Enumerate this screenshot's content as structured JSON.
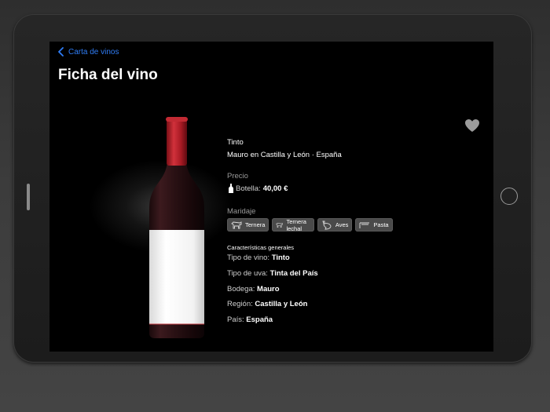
{
  "nav": {
    "back_label": "Carta de vinos"
  },
  "page": {
    "title": "Ficha del vino"
  },
  "wine": {
    "type": "Tinto",
    "origin": "Mauro en Castilla y León · España",
    "price_heading": "Precio",
    "price_label": "Botella:",
    "price_value": "40,00 €",
    "pairing_heading": "Maridaje",
    "pairings": [
      {
        "label": "Ternera",
        "icon": "cow-icon"
      },
      {
        "label": "Ternera lechal",
        "icon": "cow-icon"
      },
      {
        "label": "Aves",
        "icon": "bird-icon"
      },
      {
        "label": "Pasta",
        "icon": "pasta-icon"
      }
    ],
    "characteristics_heading": "Características generales",
    "characteristics": [
      {
        "label": "Tipo de vino:",
        "value": "Tinto"
      },
      {
        "label": "Tipo de uva:",
        "value": "Tinta del País"
      },
      {
        "label": "Bodega:",
        "value": "Mauro"
      },
      {
        "label": "Región:",
        "value": "Castilla y León"
      },
      {
        "label": "País:",
        "value": "España"
      }
    ]
  },
  "icons": {
    "back": "chevron-left-icon",
    "favorite": "heart-icon",
    "price": "bottle-icon"
  },
  "colors": {
    "accent": "#2f7df6",
    "background": "#000000",
    "capsule": "#b3202a",
    "chip": "#4a4a4a"
  }
}
